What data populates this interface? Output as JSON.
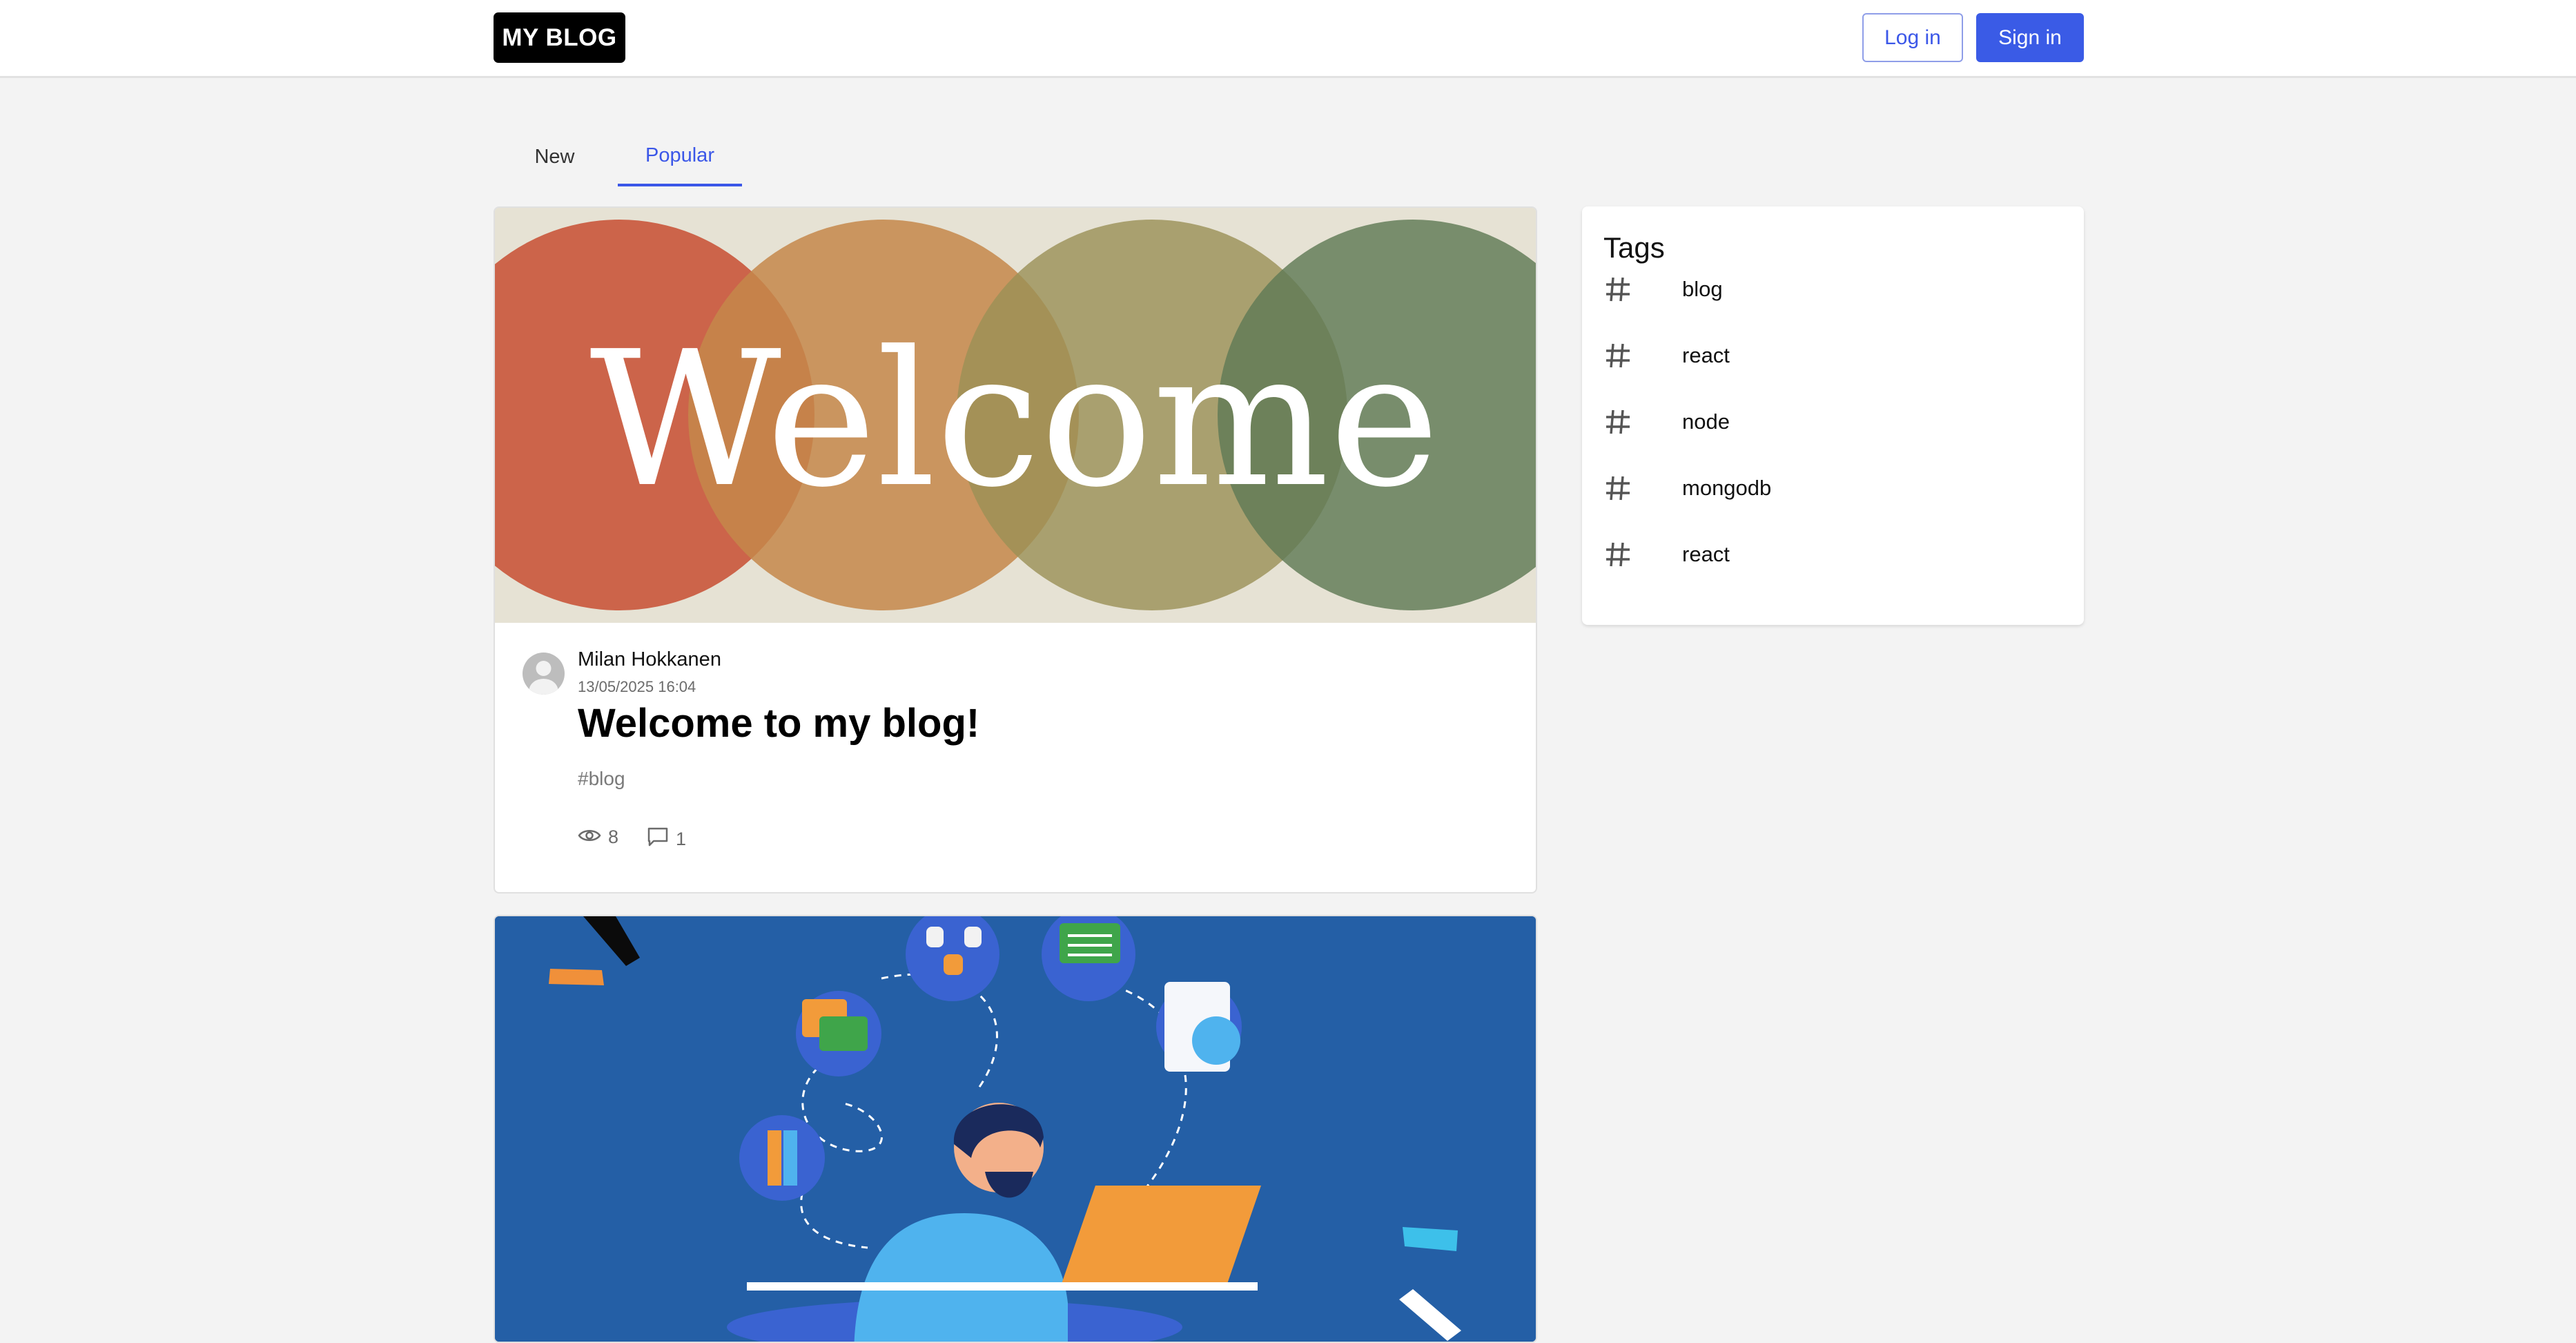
{
  "header": {
    "logo": "MY BLOG",
    "login_label": "Log in",
    "signin_label": "Sign in"
  },
  "tabs": [
    {
      "label": "New",
      "active": false
    },
    {
      "label": "Popular",
      "active": true
    }
  ],
  "posts": [
    {
      "image_text": "Welcome",
      "author": "Milan Hokkanen",
      "date": "13/05/2025 16:04",
      "title": "Welcome to my blog!",
      "tag": "#blog",
      "views": "8",
      "comments": "1"
    }
  ],
  "tags_panel": {
    "title": "Tags",
    "items": [
      "blog",
      "react",
      "node",
      "mongodb",
      "react"
    ]
  },
  "colors": {
    "accent": "#3a5be6",
    "page_bg": "#f3f3f3",
    "illustration_bg": "#245fa6"
  }
}
